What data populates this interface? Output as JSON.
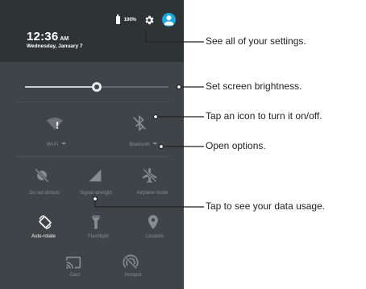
{
  "status_bar": {
    "battery": "100%",
    "settings_icon": "gear-icon",
    "profile_icon": "person-icon"
  },
  "clock": {
    "time": "12:36",
    "ampm": "AM",
    "date": "Wednesday, January 7"
  },
  "brightness": {
    "level": 0.5
  },
  "tiles": [
    {
      "label": "Wi-Fi",
      "icon": "wifi-icon",
      "dropdown": true,
      "active": false
    },
    {
      "label": "Bluetooth",
      "icon": "bluetooth-off-icon",
      "dropdown": true,
      "active": false
    },
    {
      "label": "Do not disturb",
      "icon": "do-not-disturb-icon",
      "dropdown": false,
      "active": false
    },
    {
      "label": "Signal strength",
      "icon": "signal-strength-icon",
      "dropdown": false,
      "active": false
    },
    {
      "label": "Airplane mode",
      "icon": "airplane-icon",
      "dropdown": false,
      "active": false
    },
    {
      "label": "Auto-rotate",
      "icon": "auto-rotate-icon",
      "dropdown": false,
      "active": true
    },
    {
      "label": "Flashlight",
      "icon": "flashlight-icon",
      "dropdown": false,
      "active": false
    },
    {
      "label": "Location",
      "icon": "location-icon",
      "dropdown": false,
      "active": false
    },
    {
      "label": "Cast",
      "icon": "cast-icon",
      "dropdown": false,
      "active": false
    },
    {
      "label": "Hotspot",
      "icon": "hotspot-icon",
      "dropdown": false,
      "active": false
    }
  ],
  "annotations": [
    "See all of your settings.",
    "Set screen brightness.",
    "Tap an icon to turn it on/off.",
    "Open options.",
    "Tap to see your data usage."
  ],
  "colors": {
    "panel": "#3f4448",
    "header": "#2e3336",
    "accent": "#1ea6e0",
    "inactive": "#868c90",
    "callout_line": "#222222"
  }
}
